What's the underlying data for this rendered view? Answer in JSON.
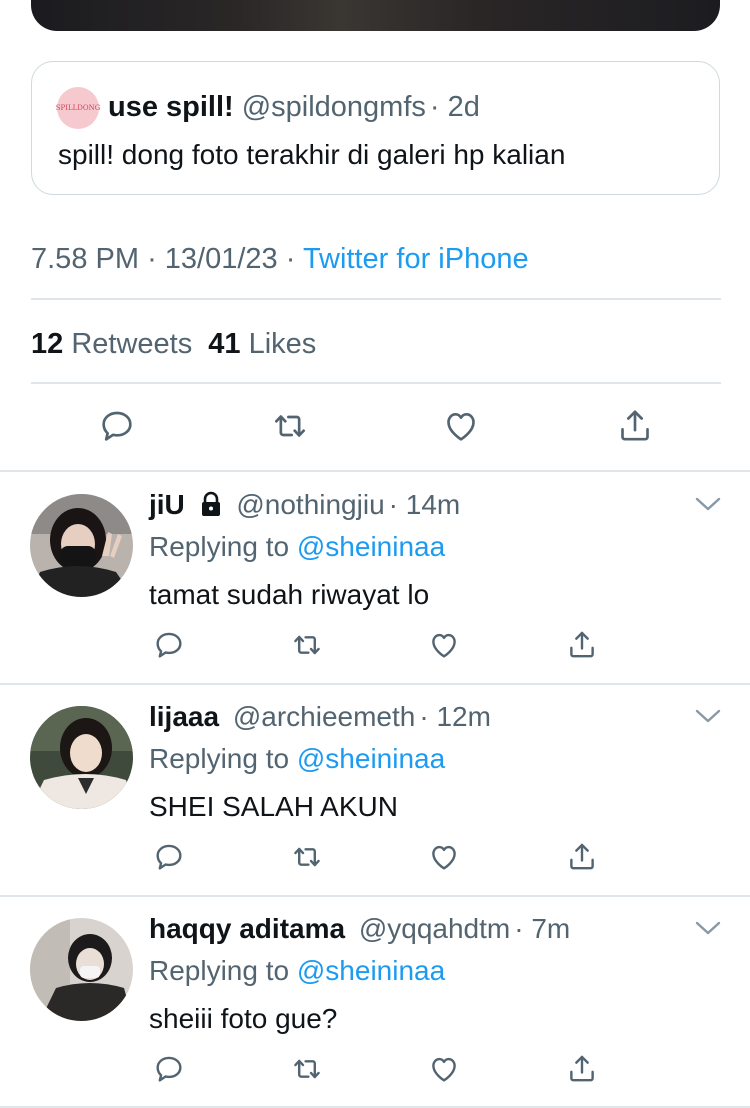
{
  "quoted_tweet": {
    "avatar_text": "SPILLDONG",
    "name": "use spill!",
    "handle": "@spildongmfs",
    "time": "· 2d",
    "text": "spill! dong foto terakhir di galeri hp kalian"
  },
  "tweet_meta": {
    "time": "7.58 PM",
    "date": "· 13/01/23 ·",
    "source": "Twitter for iPhone"
  },
  "stats": {
    "retweets_count": "12",
    "retweets_label": "Retweets",
    "likes_count": "41",
    "likes_label": "Likes"
  },
  "actions": [
    "reply-icon",
    "retweet-icon",
    "like-icon",
    "share-icon"
  ],
  "replies": [
    {
      "name": "jiU",
      "locked": true,
      "handle": "@nothingjiu",
      "time": "· 14m",
      "replying_label": "Replying to",
      "replying_to": "@sheininaa",
      "text": "tamat sudah riwayat lo"
    },
    {
      "name": "lijaaa",
      "locked": false,
      "handle": "@archieemeth",
      "time": "· 12m",
      "replying_label": "Replying to",
      "replying_to": "@sheininaa",
      "text": "SHEI SALAH AKUN"
    },
    {
      "name": "haqqy aditama",
      "locked": false,
      "handle": "@yqqahdtm",
      "time": "· 7m",
      "replying_label": "Replying to",
      "replying_to": "@sheininaa",
      "text": "sheiii foto gue?"
    }
  ],
  "colors": {
    "accent": "#1d9bf0",
    "secondary_text": "#536471",
    "divider": "#dfe5e9"
  }
}
